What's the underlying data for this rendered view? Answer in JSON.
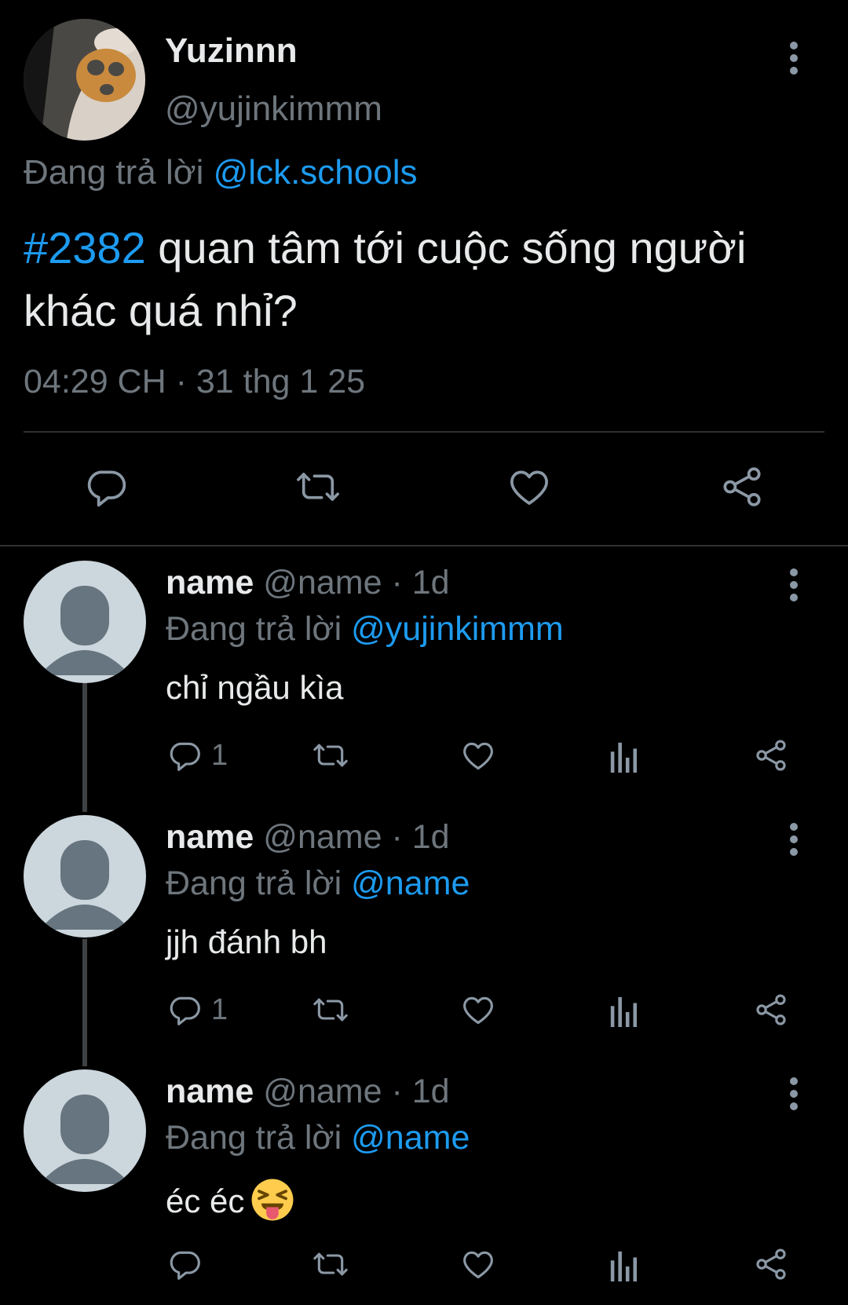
{
  "tweet": {
    "name": "Yuzinnn",
    "handle": "@yujinkimmm",
    "reply_prefix": "Đang trả lời",
    "reply_to": "@lck.schools",
    "hashtag": "#2382",
    "text": " quan tâm tới cuộc sống người khác quá nhỉ?",
    "timestamp": "04:29 CH · 31 thg 1 25",
    "actions": [
      "reply-icon",
      "retweet-icon",
      "like-icon",
      "share-icon"
    ]
  },
  "replies": [
    {
      "name": "name",
      "handle_time": " @name · 1d",
      "reply_prefix": "Đang trả lời",
      "reply_to": "@yujinkimmm",
      "text": "chỉ ngầu kìa",
      "reply_count": "1"
    },
    {
      "name": "name",
      "handle_time": " @name · 1d",
      "reply_prefix": "Đang trả lời",
      "reply_to": "@name",
      "text": "jjh đánh bh",
      "reply_count": "1"
    },
    {
      "name": "name",
      "handle_time": " @name · 1d",
      "reply_prefix": "Đang trả lời",
      "reply_to": "@name",
      "text": "éc éc",
      "reply_count": "",
      "emoji": "squinting-face-with-tongue"
    }
  ],
  "colors": {
    "background": "#000000",
    "text": "#e7e9ea",
    "muted": "#6e767d",
    "link": "#1d9bf0",
    "icon": "#8b98a5",
    "avatar_bg": "#ccd6dd",
    "avatar_fg": "#66757f"
  }
}
